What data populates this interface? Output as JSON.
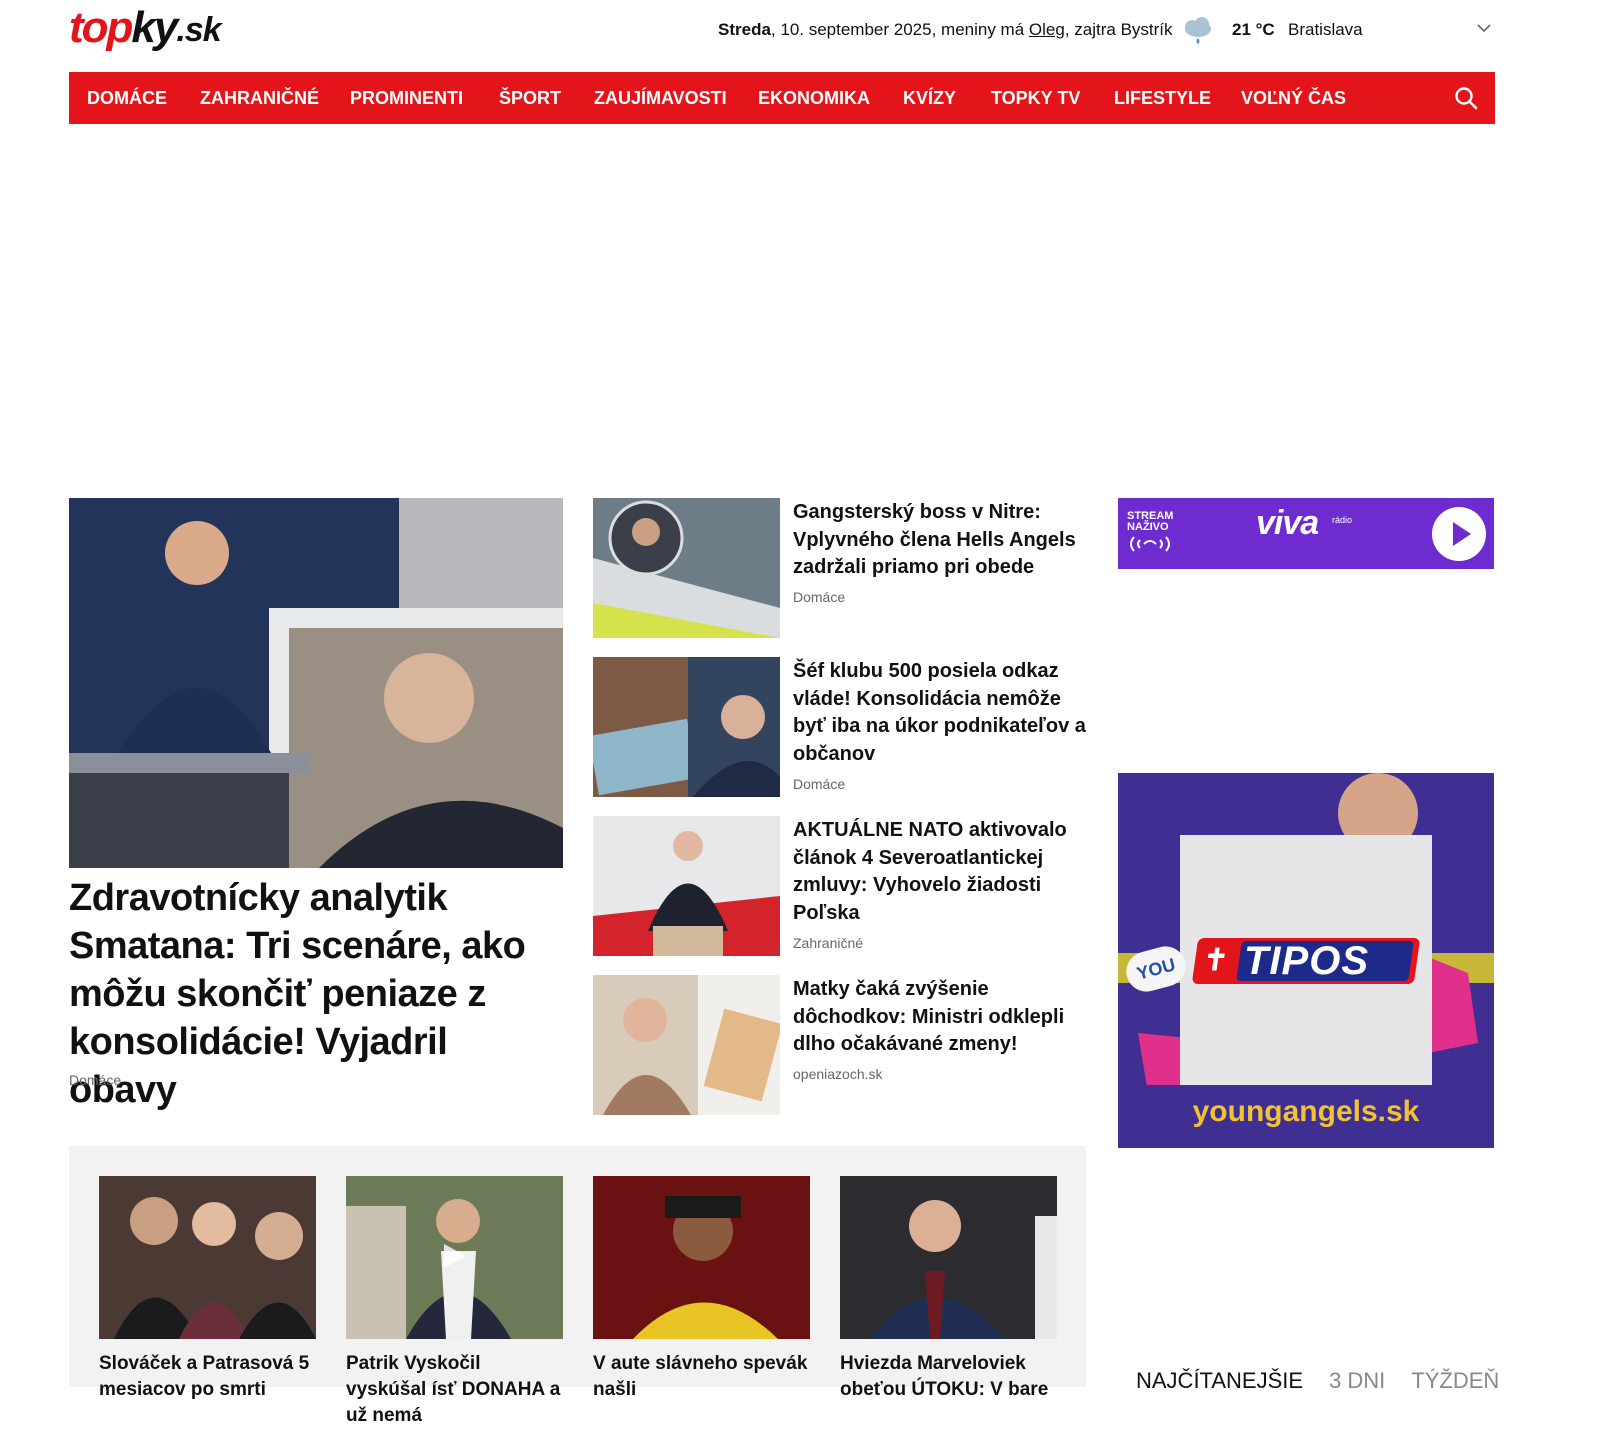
{
  "header": {
    "logo": {
      "top": "top",
      "ky": "ky",
      "sk": ".sk"
    },
    "date_day": "Streda",
    "date_rest": ", 10. september 2025, meniny má ",
    "nameday": "Oleg",
    "tomorrow": ", zajtra Bystrík",
    "temperature": "21 °C",
    "city": "Bratislava"
  },
  "nav": {
    "items": [
      "DOMÁCE",
      "ZAHRANIČNÉ",
      "PROMINENTI",
      "ŠPORT",
      "ZAUJÍMAVOSTI",
      "EKONOMIKA",
      "KVÍZY",
      "TOPKY TV",
      "LIFESTYLE",
      "VOĽNÝ ČAS"
    ]
  },
  "lead": {
    "title": "Zdravotnícky analytik Smatana: Tri scenáre, ako môžu skončiť peniaze z konsolidácie! Vyjadril obavy",
    "category": "Domáce"
  },
  "side_articles": [
    {
      "title": "Gangsterský boss v Nitre: Vplyvného člena Hells Angels zadržali priamo pri obede",
      "category": "Domáce"
    },
    {
      "title": "Šéf klubu 500 posiela odkaz vláde! Konsolidácia nemôže byť iba na úkor podnikateľov a občanov",
      "category": "Domáce"
    },
    {
      "title": "AKTUÁLNE NATO aktivovalo článok 4 Severoatlantickej zmluvy: Vyhovelo žiadosti Poľska",
      "category": "Zahraničné"
    },
    {
      "title": "Matky čaká zvýšenie dôchodkov: Ministri odklepli dlho očakávané zmeny!",
      "category": "openiazoch.sk"
    }
  ],
  "ads": {
    "viva": {
      "stream": "STREAM",
      "live": "NAŽIVO",
      "brand": "viva",
      "radio": "rádio"
    },
    "tipos": {
      "brand": "TIPOS",
      "url": "youngangels.sk",
      "badge": "YOU"
    }
  },
  "strip_articles": [
    {
      "title": "Slováček a Patrasová 5 mesiacov po smrti"
    },
    {
      "title": "Patrik Vyskočil vyskúšal ísť DONAHA a už nemá"
    },
    {
      "title": "V aute slávneho spevák našli"
    },
    {
      "title": "Hviezda Marveloviek obeťou ÚTOKU: V bare"
    }
  ],
  "tabs": [
    "NAJČÍTANEJŠIE",
    "3 DNI",
    "TÝŽDEŇ"
  ],
  "colors": {
    "brand_red": "#e3151b",
    "viva_purple": "#6e2bd0",
    "tipos_navy": "#3b2a8a"
  }
}
